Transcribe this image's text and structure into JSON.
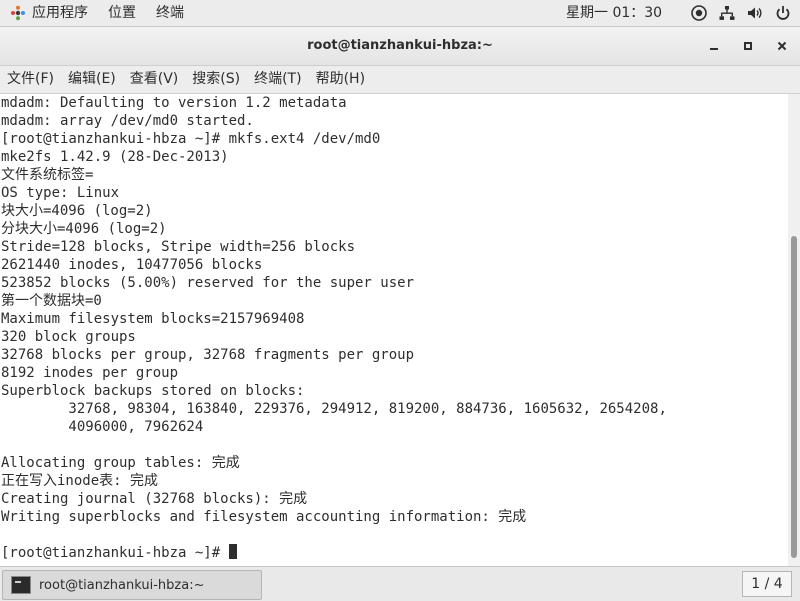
{
  "topbar": {
    "menu": [
      {
        "label": "应用程序",
        "icon": "apps-icon"
      },
      {
        "label": "位置"
      },
      {
        "label": "终端"
      }
    ],
    "clock": "星期一 01：30",
    "tray": [
      {
        "icon": "accessibility-icon"
      },
      {
        "icon": "network-icon"
      },
      {
        "icon": "volume-icon"
      },
      {
        "icon": "power-icon"
      }
    ]
  },
  "window": {
    "title": "root@tianzhankui-hbza:~",
    "buttons": {
      "minimize": "minimize-icon",
      "maximize": "maximize-icon",
      "close": "close-icon"
    }
  },
  "menubar": [
    {
      "label": "文件(F)"
    },
    {
      "label": "编辑(E)"
    },
    {
      "label": "查看(V)"
    },
    {
      "label": "搜索(S)"
    },
    {
      "label": "终端(T)"
    },
    {
      "label": "帮助(H)"
    }
  ],
  "terminal": {
    "lines": [
      "mdadm: Defaulting to version 1.2 metadata",
      "mdadm: array /dev/md0 started.",
      "[root@tianzhankui-hbza ~]# mkfs.ext4 /dev/md0",
      "mke2fs 1.42.9 (28-Dec-2013)",
      "文件系统标签=",
      "OS type: Linux",
      "块大小=4096 (log=2)",
      "分块大小=4096 (log=2)",
      "Stride=128 blocks, Stripe width=256 blocks",
      "2621440 inodes, 10477056 blocks",
      "523852 blocks (5.00%) reserved for the super user",
      "第一个数据块=0",
      "Maximum filesystem blocks=2157969408",
      "320 block groups",
      "32768 blocks per group, 32768 fragments per group",
      "8192 inodes per group",
      "Superblock backups stored on blocks:",
      "        32768, 98304, 163840, 229376, 294912, 819200, 884736, 1605632, 2654208,",
      "        4096000, 7962624",
      "",
      "Allocating group tables: 完成",
      "正在写入inode表: 完成",
      "Creating journal (32768 blocks): 完成",
      "Writing superblocks and filesystem accounting information: 完成",
      "",
      "[root@tianzhankui-hbza ~]# "
    ],
    "colors": {
      "text": "#2e2e2e",
      "background": "#ffffff"
    }
  },
  "taskbar": {
    "task_label": "root@tianzhankui-hbza:~",
    "workspace": "1 / 4"
  }
}
